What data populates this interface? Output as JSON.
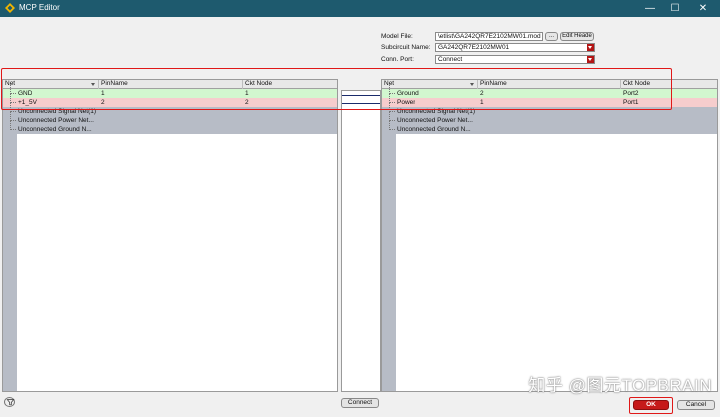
{
  "window": {
    "title": "MCP Editor",
    "titlebar_color": "#1e5a6e",
    "controls": [
      "—",
      "☐",
      "✕"
    ]
  },
  "form": {
    "model_file_label": "Model File:",
    "model_file_value": "\\etlist\\GA242QR7E2102MW01.mod",
    "browse_label": "...",
    "edit_header_label": "Edit Heade",
    "subcircuit_label": "Subcircuit Name:",
    "subcircuit_value": "GA242QR7E2102MW01",
    "conn_port_label": "Conn. Port:",
    "conn_port_value": "Connect",
    "dropdown_color": "#b41515"
  },
  "left_grid": {
    "columns": [
      "Net",
      "PinName",
      "Ckt Node"
    ],
    "rows": [
      {
        "net": "GND",
        "pin": "1",
        "node": "1",
        "color": "#d2f7cf"
      },
      {
        "net": "+1_5V",
        "pin": "2",
        "node": "2",
        "color": "#f6cdcd"
      }
    ],
    "groups": [
      "Unconnected Signal Net(1)",
      "Unconnected Power Net...",
      "Unconnected Ground N..."
    ]
  },
  "right_grid": {
    "columns": [
      "Net",
      "PinName",
      "Ckt Node"
    ],
    "rows": [
      {
        "net": "Ground",
        "pin": "2",
        "node": "Port2",
        "color": "#d2f7cf"
      },
      {
        "net": "Power",
        "pin": "1",
        "node": "Port1",
        "color": "#f6cdcd"
      }
    ],
    "groups": [
      "Unconnected Signal Net(1)",
      "Unconnected Power Net...",
      "Unconnected Ground N..."
    ]
  },
  "buttons": {
    "connect": "Connect",
    "ok": "OK",
    "cancel": "Cancel"
  },
  "highlight_color": "#e01818",
  "watermark": "知乎 @图元TOPBRAIN"
}
